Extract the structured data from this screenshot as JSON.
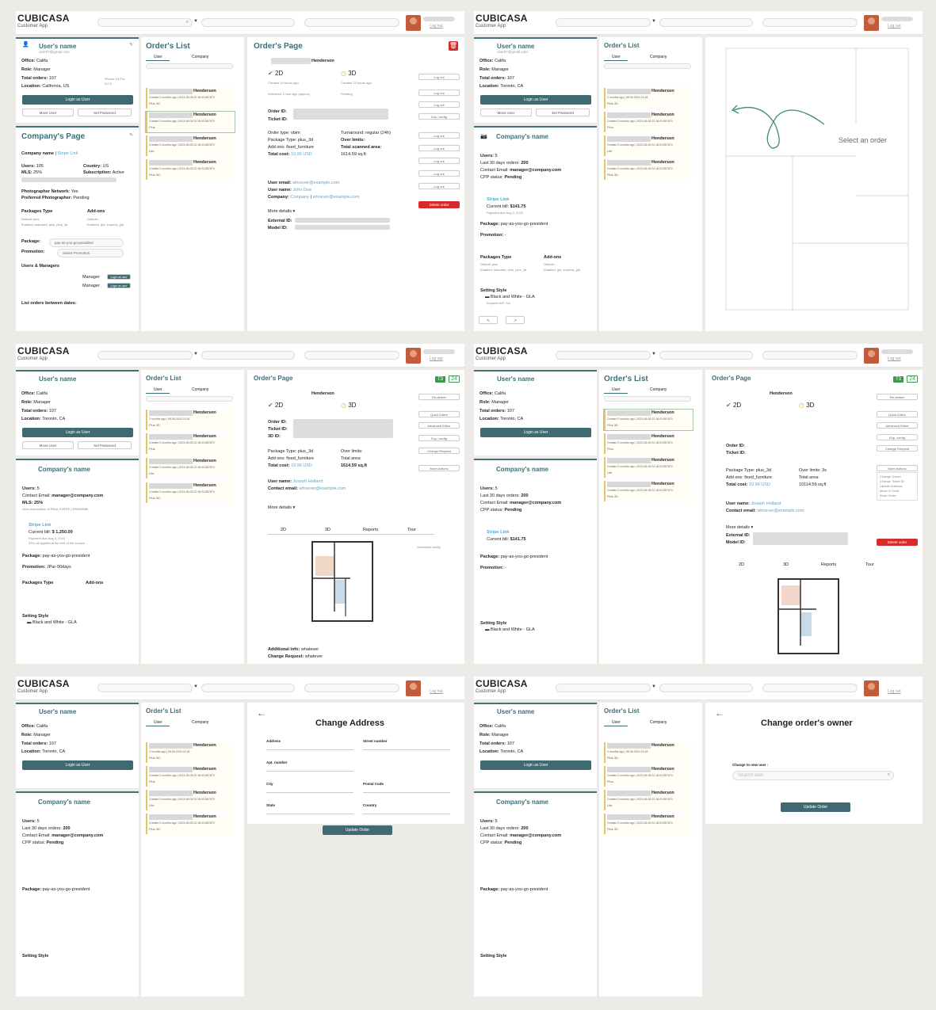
{
  "app": {
    "brand": "CUBICASA",
    "subtitle": "Customer App",
    "logout": "Log out",
    "filter_icon": "filter-icon"
  },
  "user": {
    "title": "User's name",
    "email": "user07@gmail.com",
    "office": "Califa",
    "role": "Manager",
    "orders": "107",
    "location_us": "California, US",
    "location_ca": "Toronto, CA",
    "device": "iPhone 15 Pro",
    "app_version": "3.0.5",
    "login_as": "Login as User",
    "move_user": "Move User",
    "set_password": "Set Password"
  },
  "labels": {
    "office": "Office:",
    "role": "Role:",
    "total_orders": "Total orders:",
    "location": "Location:",
    "users": "Users:",
    "mls": "MLS:",
    "country": "Country:",
    "subscription": "Subscription:",
    "company_name": "Company name",
    "stripe": "Stripe Link",
    "photog": "Photographer Network:",
    "pref": "Preferred Photographer:",
    "packages": "Packages Type",
    "addons": "Add-ons",
    "default": "Default:",
    "enabled": "Enabled:",
    "package": "Package:",
    "promotion": "Promotion:",
    "users_mgr": "Users & Managers",
    "list_between": "List orders between dates:",
    "last30": "Last 30 days orders:",
    "contact": "Contact Email:",
    "cpp": "CPP status:",
    "current_bill": "Current bill:",
    "setting_style": "Setting Style",
    "exporter": "Exporter API: No"
  },
  "company": {
    "title1": "Company's Page",
    "title2": "Company's name",
    "users": "105",
    "mls": "25%",
    "country": "US",
    "subscription": "Active",
    "photog": "Yes",
    "pref": "Pending",
    "pkg_default": "plus",
    "pkg_enabled": "standard, plus, plus_3d",
    "add_default": "-",
    "add_enabled": "gla, express_gla",
    "package": "pay-as-you-go-president",
    "promotion_sel": "Select Promotion",
    "manager": "Manager",
    "login_as": "Login as user",
    "users2": "5",
    "last30": "200",
    "contact": "manager@company.com",
    "cpp": "Pending",
    "bill": "$141.75",
    "bill2": "$ 1,250.00",
    "payment_due": "Payment due Aug 3, 2024",
    "promo2": "-",
    "promo3": "JPar-90days",
    "style": "Black and White - GLA",
    "style_tag": "default",
    "mls_org": "Allen Association of REALTORS® | 999999955",
    "applied": "25% off applied at the end of the invoice"
  },
  "orders": {
    "title": "Order's List",
    "tab_user": "User",
    "tab_company": "Company",
    "name": "Henderson",
    "created": "Created 2 months ago | 2023-06-08 22:18:03.857870",
    "created2": "2 months ago | 08.06.2024 22:18",
    "packages": [
      "Plus 3D",
      "Plus",
      "Lite",
      "Plus 3D"
    ]
  },
  "order": {
    "title": "Order's Page",
    "name": "Henderson",
    "t2d": "2D",
    "t3d": "3D",
    "created": "Created 24 hours ago",
    "created_date": "2023-01-08 22:18:03.857870",
    "delivered": "Delivered 1 hour ago (approx)",
    "pending": "Pending",
    "order_id": "Order ID:",
    "ticket_id": "Ticket ID:",
    "id3d": "3D ID:",
    "order_type": "Order type: vbim",
    "package_type": "Package Type: plus_3d",
    "add_ons": "Add ons: fixed_furniture",
    "total_cost": "Total cost:",
    "cost": "19.99 USD",
    "turnaround": "Turnaround: regular (24h)",
    "over_limits": "Over limits:",
    "over_limits2": "Over limits: 3x",
    "total_area": "Total scanned area:",
    "total_area2": "Total area:",
    "area": "1614.59 sq.ft",
    "area2": "10114.59 sq.ft",
    "user_email": "User email:",
    "email": "whoever@example.com",
    "user_name": "User name:",
    "uname": "John Doe",
    "uname2": "Joseph Holland",
    "company": "Company:",
    "company_v": "Company",
    "contact_email": "Contact email:",
    "more": "More details",
    "external": "External ID:",
    "model": "Model ID:",
    "log_out": "Log out",
    "delete": "Delete order",
    "redeliver": "Re-deliver",
    "quick": "Quick Editor",
    "advanced": "Advanced Editor",
    "exp": "Exp. config",
    "change_req": "Change Request",
    "more_actions": "More Actions",
    "actions": [
      "Change Owner",
      "Change Ticket ID",
      "Update Address",
      "Move to Draft",
      "Rush Order"
    ],
    "tabs": [
      "2D",
      "3D",
      "Reports",
      "Tour"
    ],
    "download": "Download config",
    "additional": "Additional info:",
    "whatever": "whatever",
    "change_request": "Change Request:",
    "t3": "T3",
    "t24": "24"
  },
  "empty": {
    "select": "Select an order"
  },
  "address": {
    "title": "Change Address",
    "address": "Address",
    "street": "Street number",
    "apt": "Apt. number",
    "city": "City",
    "postal": "Postal Code",
    "state": "State",
    "country": "Country",
    "update": "Update Order"
  },
  "owner": {
    "title": "Change order's owner",
    "label": "Change to new user :",
    "placeholder": "Search user",
    "update": "Update Order"
  },
  "colors": {
    "teal": "#3f6a72",
    "red": "#d62b2b",
    "green": "#3a9a4a",
    "yellow": "#e4c36a"
  }
}
